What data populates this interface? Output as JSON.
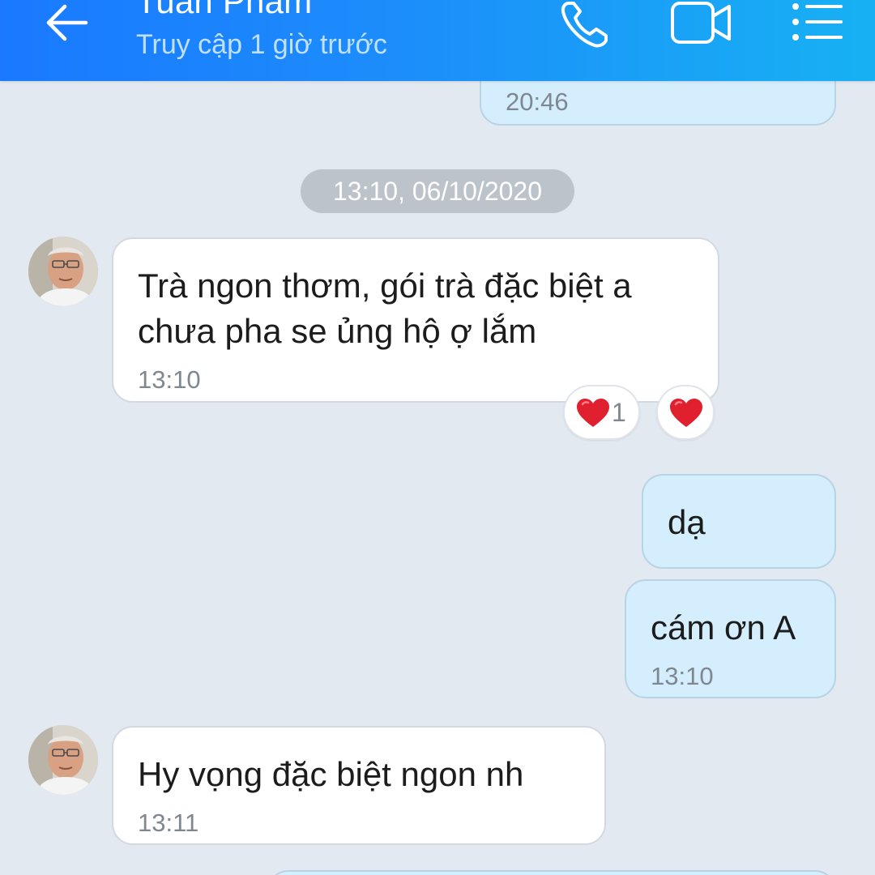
{
  "header": {
    "contact_name": "Tuan Pham",
    "status": "Truy cập 1 giờ trước",
    "back_icon": "arrow-left-icon",
    "call_icon": "phone-icon",
    "video_icon": "video-camera-icon",
    "menu_icon": "list-menu-icon"
  },
  "colors": {
    "header_gradient_start": "#1a79ff",
    "header_gradient_end": "#17b1f3",
    "background": "#e2e9f1",
    "incoming_bubble": "#ffffff",
    "outgoing_bubble": "#d5eefd",
    "heart": "#e0202f"
  },
  "conversation": {
    "prev_message": {
      "time": "20:46"
    },
    "date_separator": "13:10, 06/10/2020",
    "messages": [
      {
        "direction": "incoming",
        "lines": [
          "Trà ngon thơm, gói trà đặc biệt a",
          "chưa pha se ủng hộ ợ lắm"
        ],
        "time": "13:10",
        "reactions": {
          "summary_icon": "heart-icon",
          "count": "1",
          "react_button_icon": "heart-icon"
        }
      },
      {
        "direction": "outgoing",
        "text": "dạ"
      },
      {
        "direction": "outgoing",
        "text": "cám ơn A",
        "time": "13:10"
      },
      {
        "direction": "incoming",
        "text": "Hy vọng đặc biệt ngon nh",
        "time": "13:11"
      }
    ]
  }
}
